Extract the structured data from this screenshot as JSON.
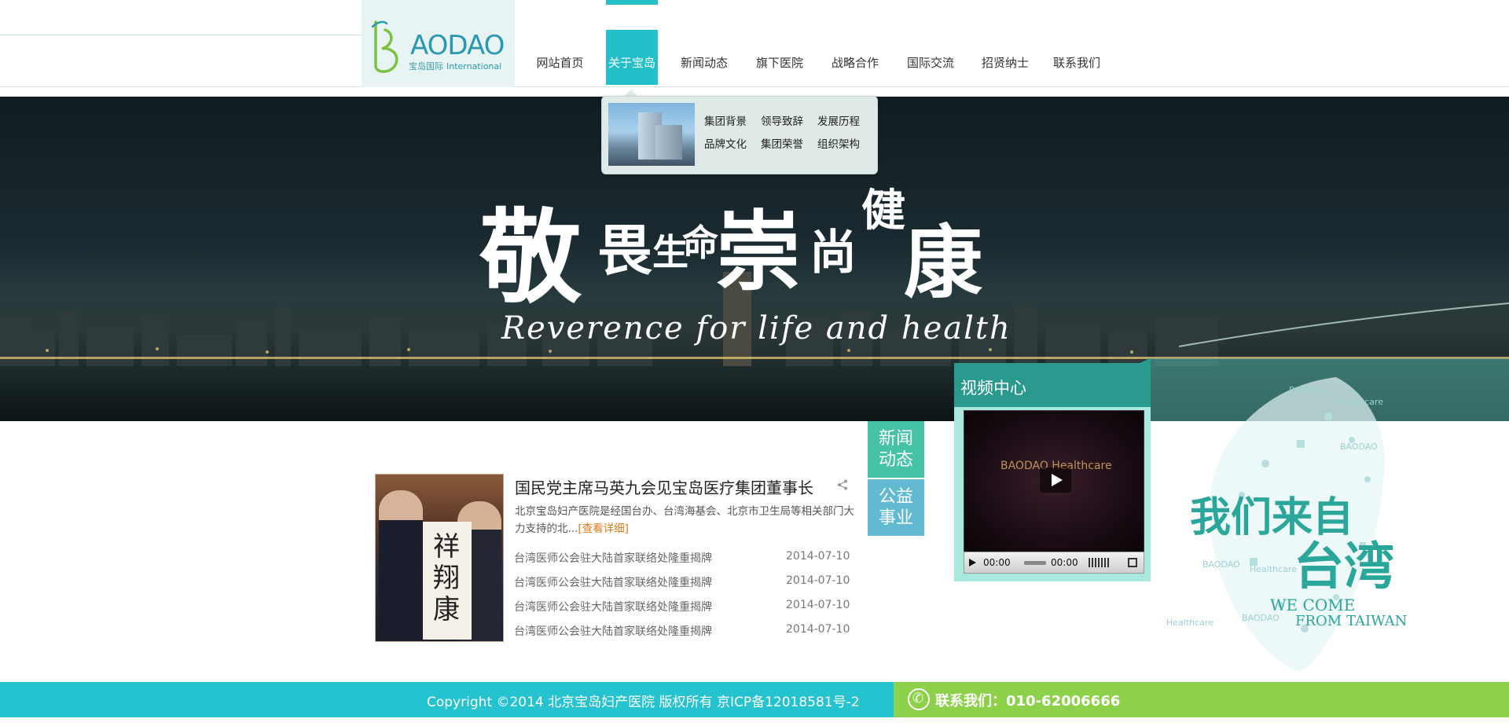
{
  "header": {
    "logo": {
      "word": "AODAO",
      "sub_cn": "宝岛国际",
      "sub_en": "International"
    },
    "nav": [
      {
        "label": "网站首页"
      },
      {
        "label": "关于宝岛"
      },
      {
        "label": "新闻动态"
      },
      {
        "label": "旗下医院"
      },
      {
        "label": "战略合作"
      },
      {
        "label": "国际交流"
      },
      {
        "label": "招贤纳士"
      },
      {
        "label": "联系我们"
      }
    ],
    "active_nav": "关于宝岛",
    "accent_color": "#23c0c9"
  },
  "dropdown": {
    "links": [
      "集团背景",
      "领导致辞",
      "发展历程",
      "品牌文化",
      "集团荣誉",
      "组织架构"
    ]
  },
  "banner": {
    "slogan_cn": [
      "敬",
      "畏",
      "生",
      "命",
      "崇",
      "尚",
      "健",
      "康"
    ],
    "slogan_en": "Reverence for life and health"
  },
  "video": {
    "title": "视频中心",
    "logo_text": "BAODAO Healthcare",
    "current_time": "00:00",
    "duration": "00:00"
  },
  "tabs": {
    "news": [
      "新闻",
      "动态"
    ],
    "charity": [
      "公益",
      "事业"
    ]
  },
  "news": {
    "photo_chars": [
      "祥",
      "翔",
      "康"
    ],
    "headline": "国民党主席马英九会见宝岛医疗集团董事长",
    "summary": "北京宝岛妇产医院是经国台办、台湾海基会、北京市卫生局等相关部门大力支持的北...",
    "more_label": "[查看详细]",
    "items": [
      {
        "title": "台湾医师公会驻大陆首家联络处隆重揭牌",
        "date": "2014-07-10"
      },
      {
        "title": "台湾医师公会驻大陆首家联络处隆重揭牌",
        "date": "2014-07-10"
      },
      {
        "title": "台湾医师公会驻大陆首家联络处隆重揭牌",
        "date": "2014-07-10"
      },
      {
        "title": "台湾医师公会驻大陆首家联络处隆重揭牌",
        "date": "2014-07-10"
      }
    ]
  },
  "art": {
    "cn_line1": "我们来自",
    "cn_line2": "台湾",
    "en_line1": "WE COME",
    "en_line2": "FROM TAIWAN",
    "small_words": [
      "BAODAO",
      "Healthcare",
      "BAODAO",
      "BAODAO",
      "Healthcare",
      "BAODAO",
      "Healthcare"
    ]
  },
  "footer": {
    "copyright": "Copyright ©2014 北京宝岛妇产医院 版权所有 京ICP备12018581号-2",
    "contact": "联系我们：010-62006666",
    "left_color": "#25c2cf",
    "right_color": "#8dd14a"
  }
}
